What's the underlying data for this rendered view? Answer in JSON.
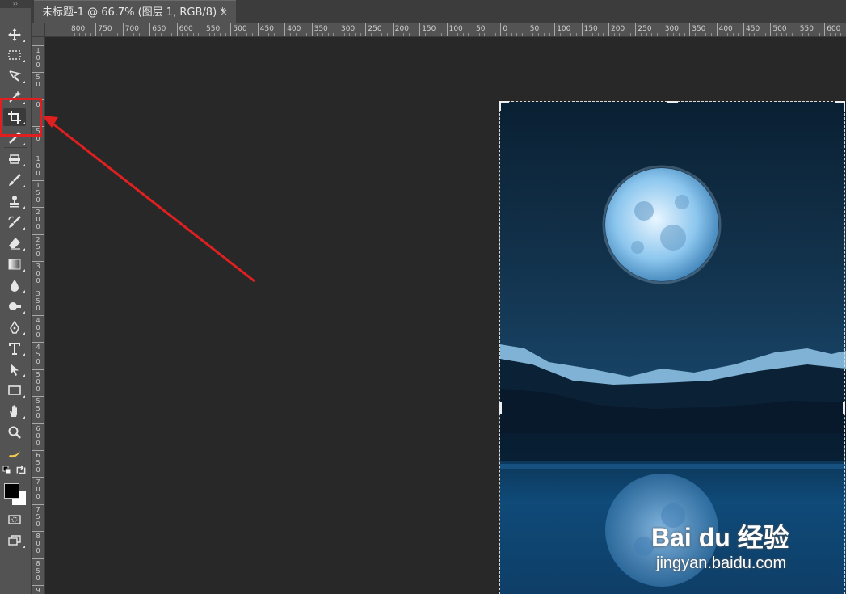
{
  "document_tab": {
    "title": "未标题-1 @ 66.7% (图层 1, RGB/8) *",
    "close_label": "×"
  },
  "ruler_top_labels": [
    "800",
    "750",
    "700",
    "650",
    "600",
    "550",
    "500",
    "450",
    "400",
    "350",
    "300",
    "250",
    "200",
    "150",
    "100",
    "50",
    "0",
    "50",
    "100",
    "150",
    "200",
    "250",
    "300",
    "350",
    "400",
    "450",
    "500",
    "550",
    "600"
  ],
  "ruler_left_labels": [
    "100",
    "50",
    "0",
    "50",
    "100",
    "150",
    "200",
    "250",
    "300",
    "350",
    "400",
    "450",
    "500",
    "550",
    "600",
    "650",
    "700",
    "750",
    "800",
    "850",
    "900"
  ],
  "toolbar": {
    "grip": "››",
    "tools": [
      "move-tool",
      "marquee-tool",
      "lasso-tool",
      "magic-wand-tool",
      "crop-tool",
      "eyedropper-tool",
      "healing-tool",
      "brush-tool",
      "stamp-tool",
      "history-brush-tool",
      "eraser-tool",
      "gradient-tool",
      "blur-tool",
      "dodge-tool",
      "pen-tool",
      "type-tool",
      "path-selection-tool",
      "rectangle-tool",
      "hand-tool",
      "zoom-tool",
      "banana-tool"
    ],
    "active_tool": "crop-tool"
  },
  "colors": {
    "foreground": "#000000",
    "background": "#ffffff",
    "annotation": "#e02020"
  },
  "watermark": {
    "main": "Bai du 经验",
    "sub": "jingyan.baidu.com"
  }
}
